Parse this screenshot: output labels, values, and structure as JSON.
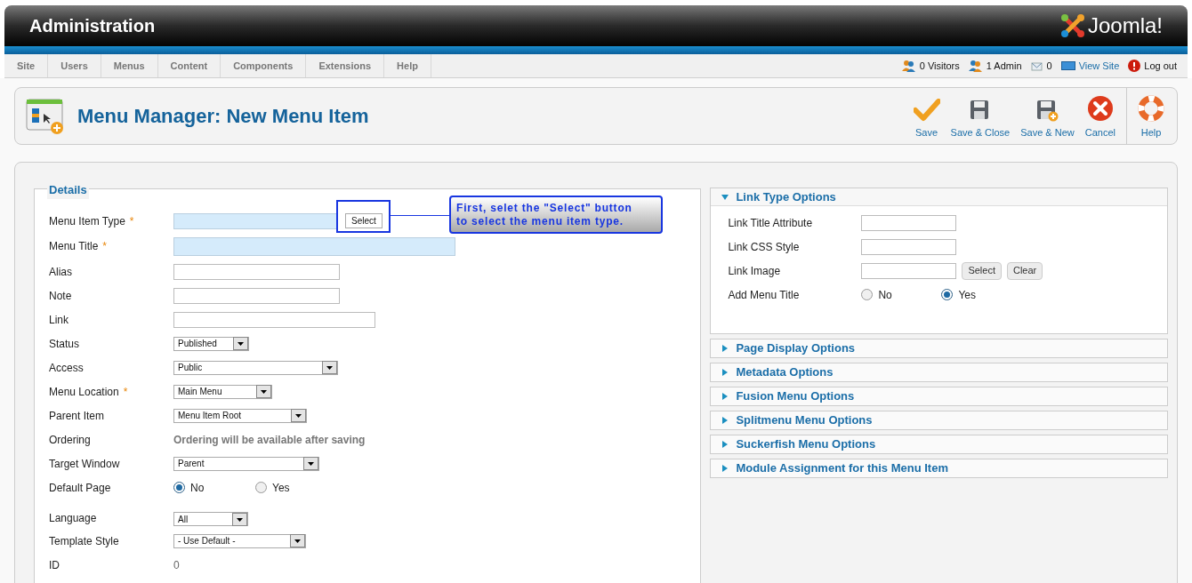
{
  "header": {
    "title": "Administration",
    "logo_text": "Joomla!"
  },
  "menu": [
    {
      "label": "Site"
    },
    {
      "label": "Users"
    },
    {
      "label": "Menus"
    },
    {
      "label": "Content"
    },
    {
      "label": "Components"
    },
    {
      "label": "Extensions"
    },
    {
      "label": "Help"
    }
  ],
  "status": [
    {
      "kind": "visitors",
      "text": "0 Visitors"
    },
    {
      "kind": "admins",
      "text": "1 Admin"
    },
    {
      "kind": "messages",
      "text": "0"
    },
    {
      "kind": "view_site",
      "text": "View Site"
    },
    {
      "kind": "logout",
      "text": "Log out"
    }
  ],
  "page_title": "Menu Manager: New Menu Item",
  "toolbar": [
    {
      "kind": "save",
      "label": "Save"
    },
    {
      "kind": "save_close",
      "label": "Save & Close"
    },
    {
      "kind": "save_new",
      "label": "Save & New"
    },
    {
      "kind": "cancel",
      "label": "Cancel"
    },
    {
      "kind": "help",
      "label": "Help"
    }
  ],
  "details": {
    "legend": "Details",
    "fields": [
      {
        "label": "Menu Item Type",
        "mark": "*",
        "kind": "text",
        "highlighted": true,
        "button": "Select"
      },
      {
        "label": "Menu Title",
        "mark": "*",
        "kind": "text",
        "highlighted": true
      },
      {
        "label": "Alias",
        "kind": "text",
        "highlighted": false
      },
      {
        "label": "Note",
        "kind": "text",
        "highlighted": false
      },
      {
        "label": "Link",
        "kind": "text",
        "highlighted": false
      },
      {
        "label": "Status",
        "kind": "select",
        "value": "Published"
      },
      {
        "label": "Access",
        "kind": "select",
        "value": "Public"
      },
      {
        "label": "Menu Location",
        "mark": "*",
        "kind": "select",
        "value": "Main Menu"
      },
      {
        "label": "Parent Item",
        "kind": "select",
        "value": "Menu Item Root"
      },
      {
        "label": "Ordering",
        "kind": "static",
        "value": "Ordering will be available after saving"
      },
      {
        "label": "Target Window",
        "kind": "select",
        "value": "Parent"
      },
      {
        "label": "Default Page",
        "kind": "radio",
        "options": [
          {
            "label": "No",
            "selected": true
          },
          {
            "label": "Yes",
            "selected": false
          }
        ]
      },
      {
        "label": "Language",
        "kind": "select",
        "value": "All"
      },
      {
        "label": "Template Style",
        "kind": "select",
        "value": "- Use Default -"
      },
      {
        "label": "ID",
        "kind": "number",
        "value": "0"
      }
    ]
  },
  "callout": {
    "line_1": "First, selet the \"Select\" button",
    "line_2": "to select the menu item type."
  },
  "panels": [
    {
      "title": "Link Type Options",
      "expanded": true,
      "fields": [
        {
          "label": "Link Title Attribute",
          "kind": "text"
        },
        {
          "label": "Link CSS Style",
          "kind": "text"
        },
        {
          "label": "Link Image",
          "kind": "text",
          "buttons": [
            "Select",
            "Clear"
          ]
        },
        {
          "label": "Add Menu Title",
          "kind": "radio",
          "options": [
            {
              "label": "No",
              "selected": false
            },
            {
              "label": "Yes",
              "selected": true
            }
          ]
        }
      ]
    },
    {
      "title": "Page Display Options",
      "expanded": false
    },
    {
      "title": "Metadata Options",
      "expanded": false
    },
    {
      "title": "Fusion Menu Options",
      "expanded": false
    },
    {
      "title": "Splitmenu Menu Options",
      "expanded": false
    },
    {
      "title": "Suckerfish Menu Options",
      "expanded": false
    },
    {
      "title": "Module Assignment for this Menu Item",
      "expanded": false
    }
  ]
}
